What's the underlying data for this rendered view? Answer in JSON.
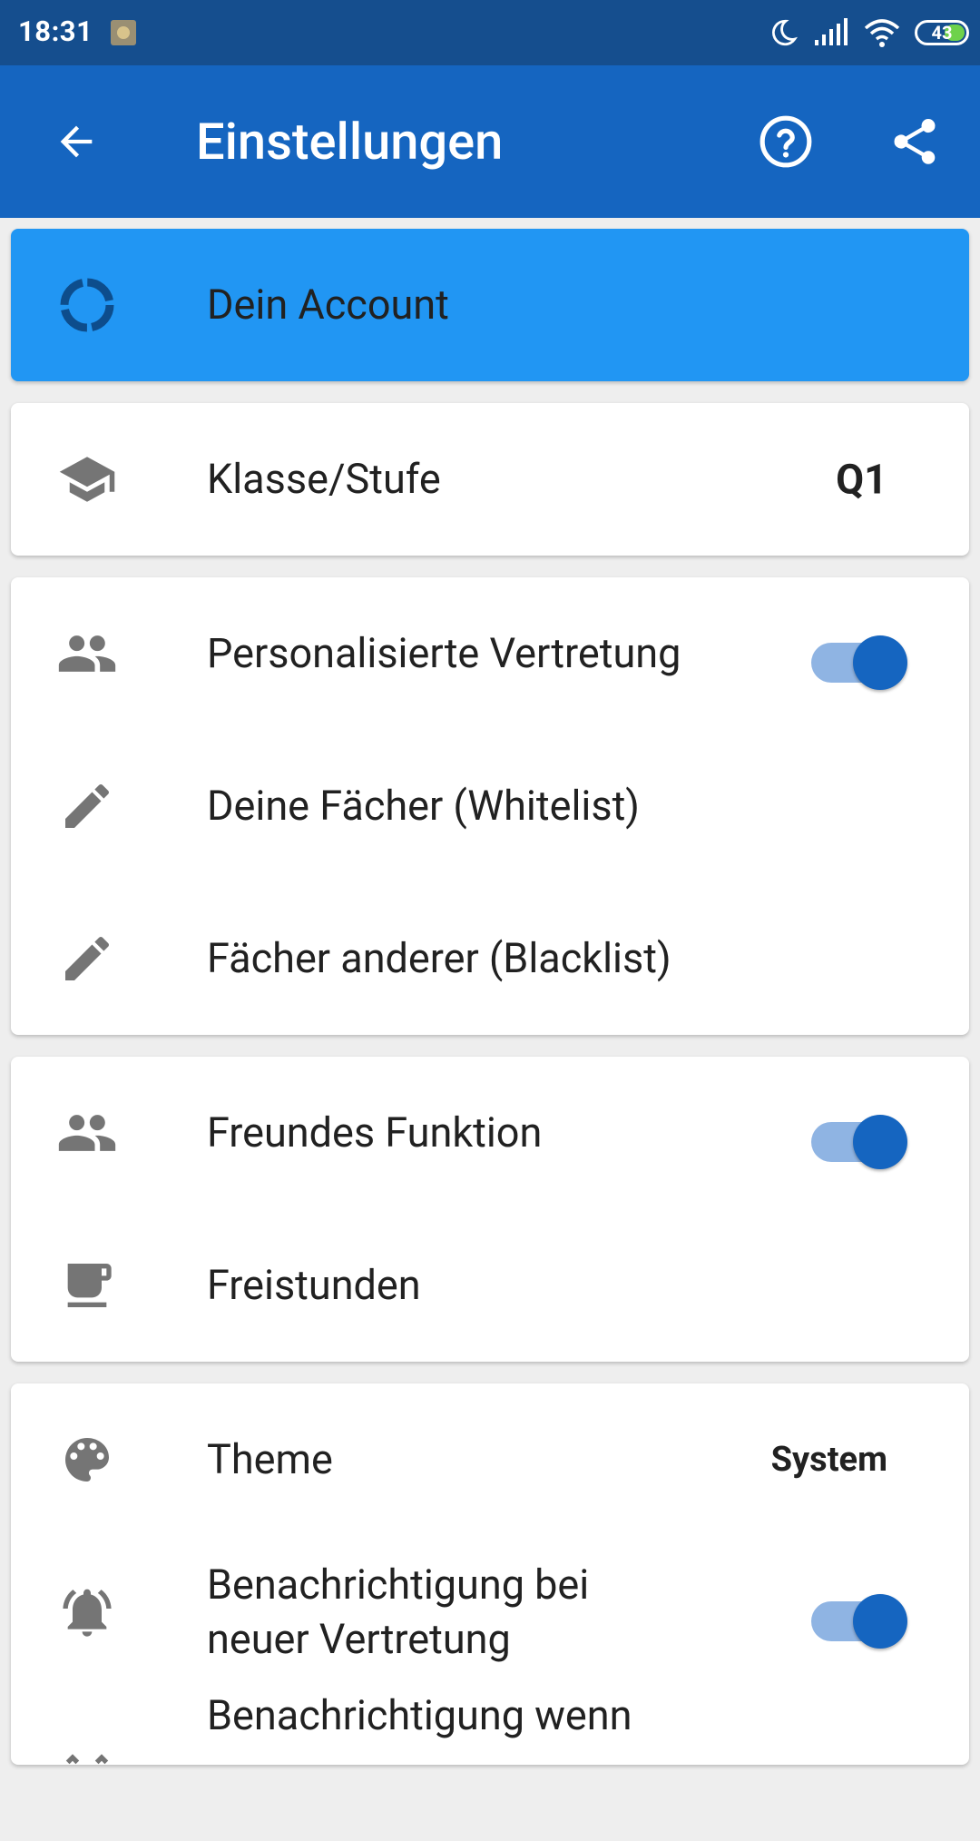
{
  "status_bar": {
    "time": "18:31",
    "battery": "43"
  },
  "app_bar": {
    "title": "Einstellungen"
  },
  "account": {
    "label": "Dein Account"
  },
  "class_row": {
    "label": "Klasse/Stufe",
    "value": "Q1"
  },
  "personalized": {
    "toggle_label": "Personalisierte Vertretung",
    "toggle_on": true,
    "whitelist_label": "Deine Fächer (Whitelist)",
    "blacklist_label": "Fächer anderer (Blacklist)"
  },
  "friends": {
    "toggle_label": "Freundes Funktion",
    "toggle_on": true,
    "free_periods_label": "Freistunden"
  },
  "general": {
    "theme_label": "Theme",
    "theme_value": "System",
    "notify_label": "Benachrichtigung bei neuer Vertretung",
    "notify_on": true,
    "notify2_label": "Benachrichtigung wenn"
  },
  "colors": {
    "status_bar": "#154e8e",
    "app_bar": "#1565c0",
    "account_card": "#2196f3",
    "switch_thumb": "#1565c0",
    "switch_track": "#8fb4e3"
  }
}
